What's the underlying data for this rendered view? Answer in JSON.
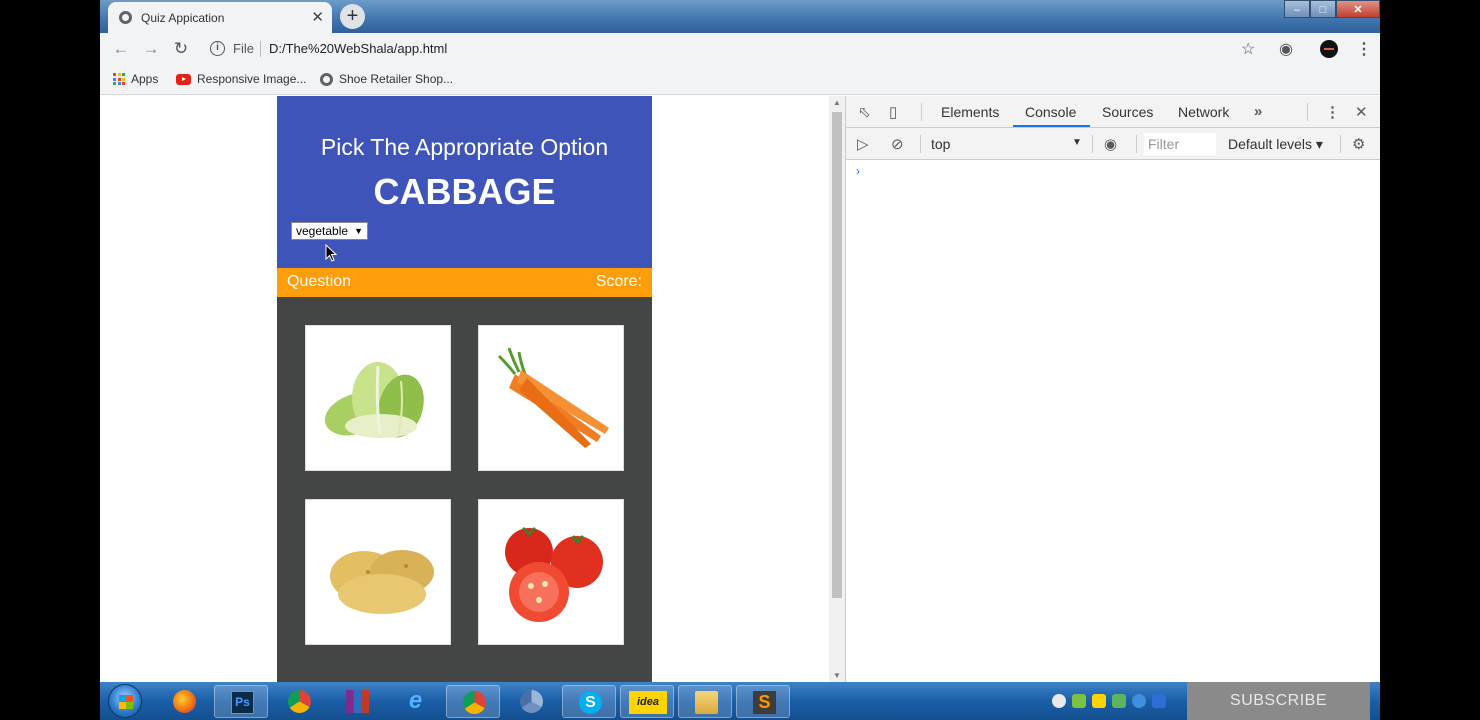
{
  "browser": {
    "tab_title": "Quiz Appication",
    "tab_close": "✕",
    "new_tab": "+",
    "omnibox": {
      "file_label": "File",
      "url": "D:/The%20WebShala/app.html"
    },
    "bookmarks": [
      {
        "label": "Apps",
        "icon": "apps-grid-icon"
      },
      {
        "label": "Responsive Image...",
        "icon": "youtube-icon"
      },
      {
        "label": "Shoe Retailer Shop...",
        "icon": "globe-icon"
      }
    ]
  },
  "quiz": {
    "heading": "Pick The Appropriate Option",
    "word": "CABBAGE",
    "category_selected": "vegetable",
    "question_label": "Question",
    "score_label": "Score:",
    "options": [
      {
        "name": "cabbage",
        "icon": "cabbage-image"
      },
      {
        "name": "carrot",
        "icon": "carrot-image"
      },
      {
        "name": "potato",
        "icon": "potato-image"
      },
      {
        "name": "tomato",
        "icon": "tomato-image"
      }
    ]
  },
  "devtools": {
    "tabs": [
      "Elements",
      "Console",
      "Sources",
      "Network"
    ],
    "active_tab": "Console",
    "context": "top",
    "filter_placeholder": "Filter",
    "levels": "Default levels",
    "prompt": "›"
  },
  "overlay": {
    "subscribe": "SUBSCRIBE"
  },
  "colors": {
    "quiz_header": "#3e54b8",
    "status_bar": "#ff9e0b",
    "quiz_body": "#444645"
  }
}
